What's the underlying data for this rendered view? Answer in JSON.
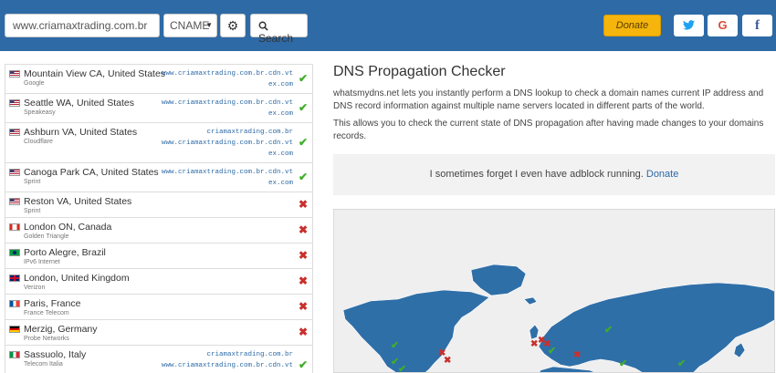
{
  "header": {
    "domain_value": "www.criamaxtrading.com.br",
    "record_type": "CNAME",
    "search_label": "Search",
    "donate_label": "Donate",
    "social": {
      "twitter": "t",
      "google": "G",
      "facebook": "f"
    }
  },
  "colors": {
    "header_bg": "#2e6aa5",
    "ok": "#3fae29",
    "fail": "#c9302c",
    "donate": "#f5b50c"
  },
  "results": [
    {
      "location": "Mountain View CA, United States",
      "provider": "Google",
      "flag": "us",
      "records": [
        "www.criamaxtrading.com.br.cdn.vt",
        "ex.com"
      ],
      "status": "ok"
    },
    {
      "location": "Seattle WA, United States",
      "provider": "Speakeasy",
      "flag": "us",
      "records": [
        "www.criamaxtrading.com.br.cdn.vt",
        "ex.com"
      ],
      "status": "ok"
    },
    {
      "location": "Ashburn VA, United States",
      "provider": "Cloudflare",
      "flag": "us",
      "records": [
        "criamaxtrading.com.br",
        "www.criamaxtrading.com.br.cdn.vt",
        "ex.com"
      ],
      "status": "ok"
    },
    {
      "location": "Canoga Park CA, United States",
      "provider": "Sprint",
      "flag": "us",
      "records": [
        "www.criamaxtrading.com.br.cdn.vt",
        "ex.com"
      ],
      "status": "ok"
    },
    {
      "location": "Reston VA, United States",
      "provider": "Sprint",
      "flag": "us",
      "records": [],
      "status": "fail"
    },
    {
      "location": "London ON, Canada",
      "provider": "Golden Triangle",
      "flag": "ca",
      "records": [],
      "status": "fail"
    },
    {
      "location": "Porto Alegre, Brazil",
      "provider": "IPv6 Internet",
      "flag": "br",
      "records": [],
      "status": "fail"
    },
    {
      "location": "London, United Kingdom",
      "provider": "Verizon",
      "flag": "gb",
      "records": [],
      "status": "fail"
    },
    {
      "location": "Paris, France",
      "provider": "France Telecom",
      "flag": "fr",
      "records": [],
      "status": "fail"
    },
    {
      "location": "Merzig, Germany",
      "provider": "Probe Networks",
      "flag": "de",
      "records": [],
      "status": "fail"
    },
    {
      "location": "Sassuolo, Italy",
      "provider": "Telecom Italia",
      "flag": "it",
      "records": [
        "criamaxtrading.com.br",
        "www.criamaxtrading.com.br.cdn.vt",
        "ex.com"
      ],
      "status": "ok"
    }
  ],
  "main": {
    "title": "DNS Propagation Checker",
    "description": "whatsmydns.net lets you instantly perform a DNS lookup to check a domain names current IP address and DNS record information against multiple name servers located in different parts of the world.",
    "description2": "This allows you to check the current state of DNS propagation after having made changes to your domains records.",
    "ad_text": "I sometimes forget I even have adblock running.",
    "ad_link": "Donate"
  },
  "icons": {
    "ok": "✔",
    "fail": "✖",
    "gear": "⚙",
    "caret": "▼"
  }
}
